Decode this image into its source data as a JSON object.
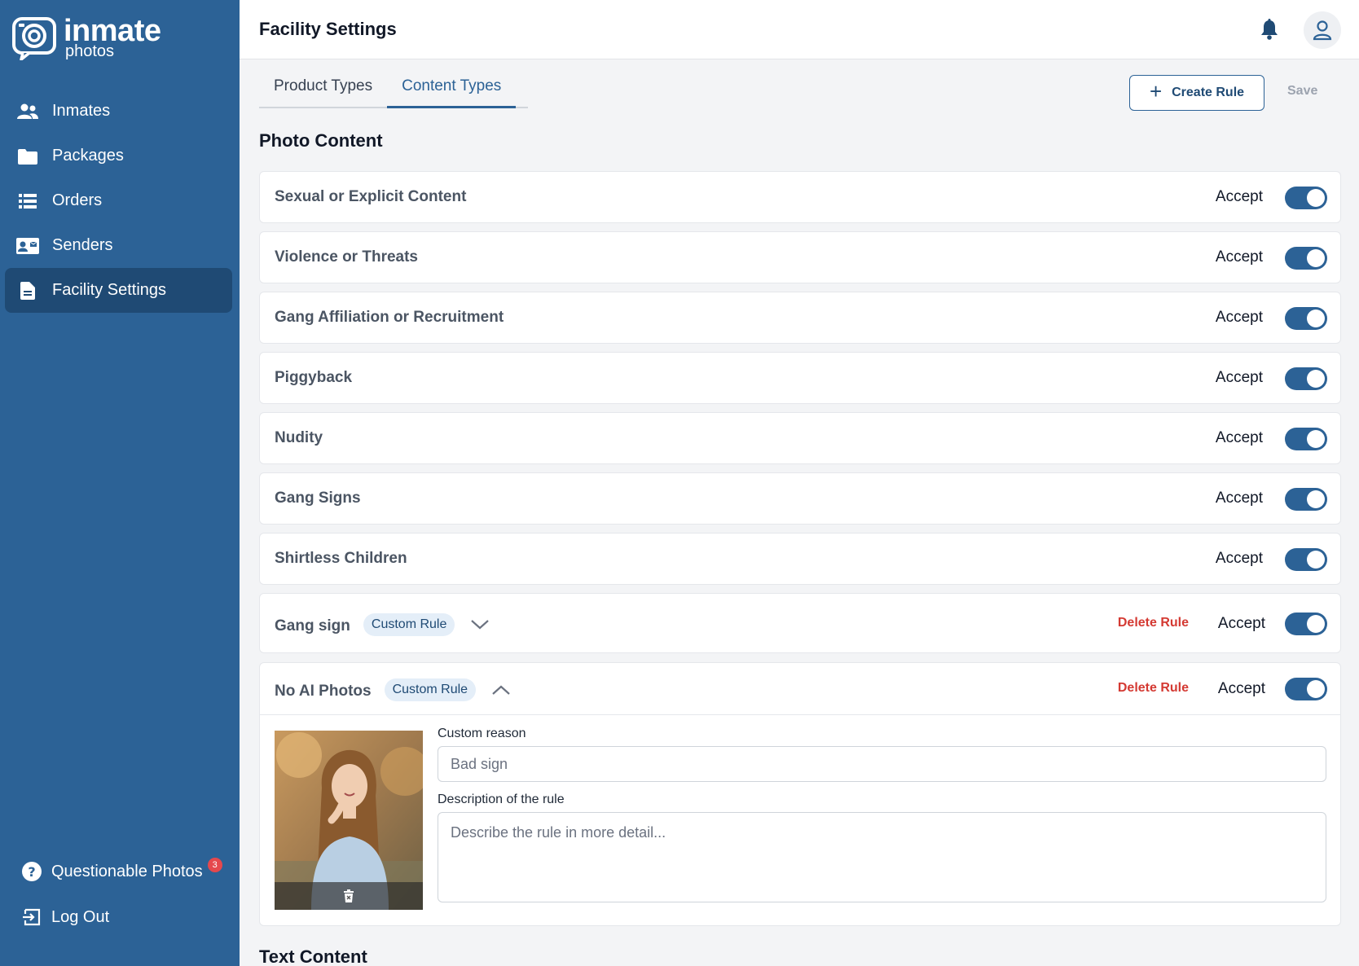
{
  "app": {
    "logo_line1": "inmate",
    "logo_line2": "photos",
    "accent_color": "#2c6296",
    "sidebar_active_color": "#1f4a74",
    "danger_color": "#d43a33"
  },
  "sidebar": {
    "items": [
      {
        "label": "Inmates",
        "icon": "users-icon"
      },
      {
        "label": "Packages",
        "icon": "folder-icon"
      },
      {
        "label": "Orders",
        "icon": "list-icon"
      },
      {
        "label": "Senders",
        "icon": "contact-card-icon"
      },
      {
        "label": "Facility Settings",
        "icon": "document-icon",
        "active": true
      }
    ],
    "bottom": [
      {
        "label": "Questionable Photos",
        "icon": "question-circle-icon",
        "badge": "3"
      },
      {
        "label": "Log Out",
        "icon": "logout-icon"
      }
    ]
  },
  "header": {
    "title": "Facility Settings"
  },
  "tabs": [
    {
      "label": "Product Types",
      "active": false
    },
    {
      "label": "Content Types",
      "active": true
    }
  ],
  "toolbar": {
    "create_label": "Create Rule",
    "save_label": "Save"
  },
  "photo_content": {
    "title": "Photo Content",
    "rules": [
      {
        "name": "Sexual or Explicit Content",
        "status": "Accept",
        "enabled": true
      },
      {
        "name": "Violence or Threats",
        "status": "Accept",
        "enabled": true
      },
      {
        "name": "Gang Affiliation or Recruitment",
        "status": "Accept",
        "enabled": true
      },
      {
        "name": "Piggyback",
        "status": "Accept",
        "enabled": true
      },
      {
        "name": "Nudity",
        "status": "Accept",
        "enabled": true
      },
      {
        "name": "Gang Signs",
        "status": "Accept",
        "enabled": true
      },
      {
        "name": "Shirtless Children",
        "status": "Accept",
        "enabled": true
      }
    ],
    "custom_rules": [
      {
        "name": "Gang sign",
        "tag": "Custom Rule",
        "delete_label": "Delete Rule",
        "status": "Accept",
        "enabled": true,
        "expanded": false
      },
      {
        "name": "No AI Photos",
        "tag": "Custom Rule",
        "delete_label": "Delete Rule",
        "status": "Accept",
        "enabled": true,
        "expanded": true,
        "reason_label": "Custom reason",
        "reason_value": "Bad sign",
        "description_label": "Description of the rule",
        "description_placeholder": "Describe the rule in more detail..."
      }
    ]
  },
  "text_content": {
    "title": "Text Content"
  }
}
